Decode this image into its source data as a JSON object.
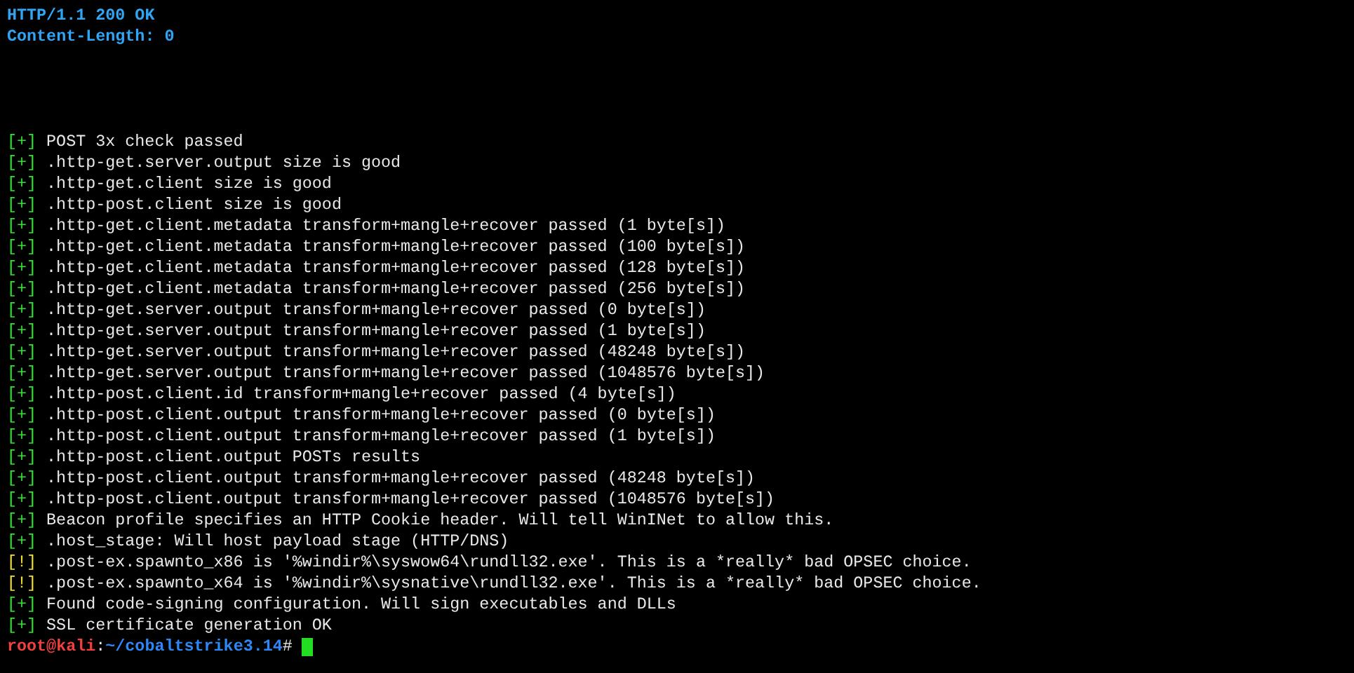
{
  "header_lines": [
    "HTTP/1.1 200 OK",
    "Content-Length: 0"
  ],
  "log": [
    {
      "kind": "ok",
      "marker": "[+]",
      "text": "POST 3x check passed"
    },
    {
      "kind": "ok",
      "marker": "[+]",
      "text": ".http-get.server.output size is good"
    },
    {
      "kind": "ok",
      "marker": "[+]",
      "text": ".http-get.client size is good"
    },
    {
      "kind": "ok",
      "marker": "[+]",
      "text": ".http-post.client size is good"
    },
    {
      "kind": "ok",
      "marker": "[+]",
      "text": ".http-get.client.metadata transform+mangle+recover passed (1 byte[s])"
    },
    {
      "kind": "ok",
      "marker": "[+]",
      "text": ".http-get.client.metadata transform+mangle+recover passed (100 byte[s])"
    },
    {
      "kind": "ok",
      "marker": "[+]",
      "text": ".http-get.client.metadata transform+mangle+recover passed (128 byte[s])"
    },
    {
      "kind": "ok",
      "marker": "[+]",
      "text": ".http-get.client.metadata transform+mangle+recover passed (256 byte[s])"
    },
    {
      "kind": "ok",
      "marker": "[+]",
      "text": ".http-get.server.output transform+mangle+recover passed (0 byte[s])"
    },
    {
      "kind": "ok",
      "marker": "[+]",
      "text": ".http-get.server.output transform+mangle+recover passed (1 byte[s])"
    },
    {
      "kind": "ok",
      "marker": "[+]",
      "text": ".http-get.server.output transform+mangle+recover passed (48248 byte[s])"
    },
    {
      "kind": "ok",
      "marker": "[+]",
      "text": ".http-get.server.output transform+mangle+recover passed (1048576 byte[s])"
    },
    {
      "kind": "ok",
      "marker": "[+]",
      "text": ".http-post.client.id transform+mangle+recover passed (4 byte[s])"
    },
    {
      "kind": "ok",
      "marker": "[+]",
      "text": ".http-post.client.output transform+mangle+recover passed (0 byte[s])"
    },
    {
      "kind": "ok",
      "marker": "[+]",
      "text": ".http-post.client.output transform+mangle+recover passed (1 byte[s])"
    },
    {
      "kind": "ok",
      "marker": "[+]",
      "text": ".http-post.client.output POSTs results"
    },
    {
      "kind": "ok",
      "marker": "[+]",
      "text": ".http-post.client.output transform+mangle+recover passed (48248 byte[s])"
    },
    {
      "kind": "ok",
      "marker": "[+]",
      "text": ".http-post.client.output transform+mangle+recover passed (1048576 byte[s])"
    },
    {
      "kind": "ok",
      "marker": "[+]",
      "text": "Beacon profile specifies an HTTP Cookie header. Will tell WinINet to allow this."
    },
    {
      "kind": "ok",
      "marker": "[+]",
      "text": ".host_stage: Will host payload stage (HTTP/DNS)"
    },
    {
      "kind": "warn",
      "marker": "[!]",
      "text": ".post-ex.spawnto_x86 is '%windir%\\syswow64\\rundll32.exe'. This is a *really* bad OPSEC choice."
    },
    {
      "kind": "warn",
      "marker": "[!]",
      "text": ".post-ex.spawnto_x64 is '%windir%\\sysnative\\rundll32.exe'. This is a *really* bad OPSEC choice."
    },
    {
      "kind": "ok",
      "marker": "[+]",
      "text": "Found code-signing configuration. Will sign executables and DLLs"
    },
    {
      "kind": "ok",
      "marker": "[+]",
      "text": "SSL certificate generation OK"
    }
  ],
  "prompt": {
    "user_host": "root@kali",
    "separator": ":",
    "path": "~/cobaltstrike3.14",
    "symbol": "#"
  }
}
